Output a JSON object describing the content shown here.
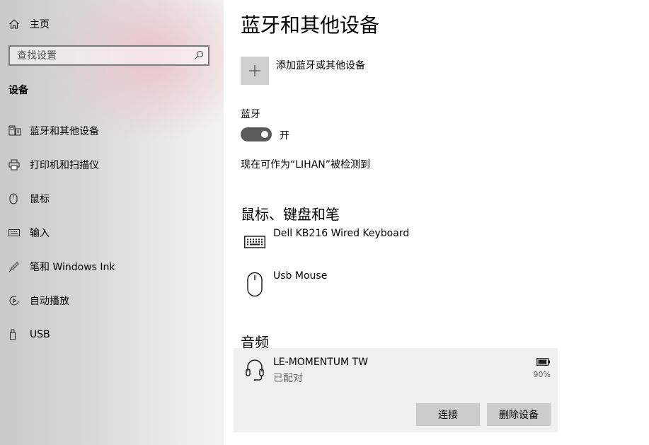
{
  "sidebar": {
    "home_label": "主页",
    "search_placeholder": "查找设置",
    "section_title": "设备",
    "items": [
      {
        "label": "蓝牙和其他设备",
        "icon": "bluetooth-devices-icon"
      },
      {
        "label": "打印机和扫描仪",
        "icon": "printer-icon"
      },
      {
        "label": "鼠标",
        "icon": "mouse-icon"
      },
      {
        "label": "输入",
        "icon": "keyboard-icon"
      },
      {
        "label": "笔和 Windows Ink",
        "icon": "pen-icon"
      },
      {
        "label": "自动播放",
        "icon": "autoplay-icon"
      },
      {
        "label": "USB",
        "icon": "usb-icon"
      }
    ]
  },
  "main": {
    "title": "蓝牙和其他设备",
    "add_device_label": "添加蓝牙或其他设备",
    "bluetooth_label": "蓝牙",
    "bluetooth_state": "开",
    "bluetooth_on": true,
    "discoverable_text": "现在可作为“LIHAN”被检测到",
    "input_group": {
      "title": "鼠标、键盘和笔",
      "devices": [
        {
          "name": "Dell KB216 Wired Keyboard",
          "icon": "keyboard-icon"
        },
        {
          "name": "Usb Mouse",
          "icon": "mouse-icon"
        }
      ]
    },
    "audio_group": {
      "title": "音频",
      "device": {
        "name": "LE-MOMENTUM TW",
        "status": "已配对",
        "battery": "90%",
        "battery_level": 0.9,
        "icon": "headset-icon"
      },
      "connect_label": "连接",
      "remove_label": "删除设备"
    }
  }
}
